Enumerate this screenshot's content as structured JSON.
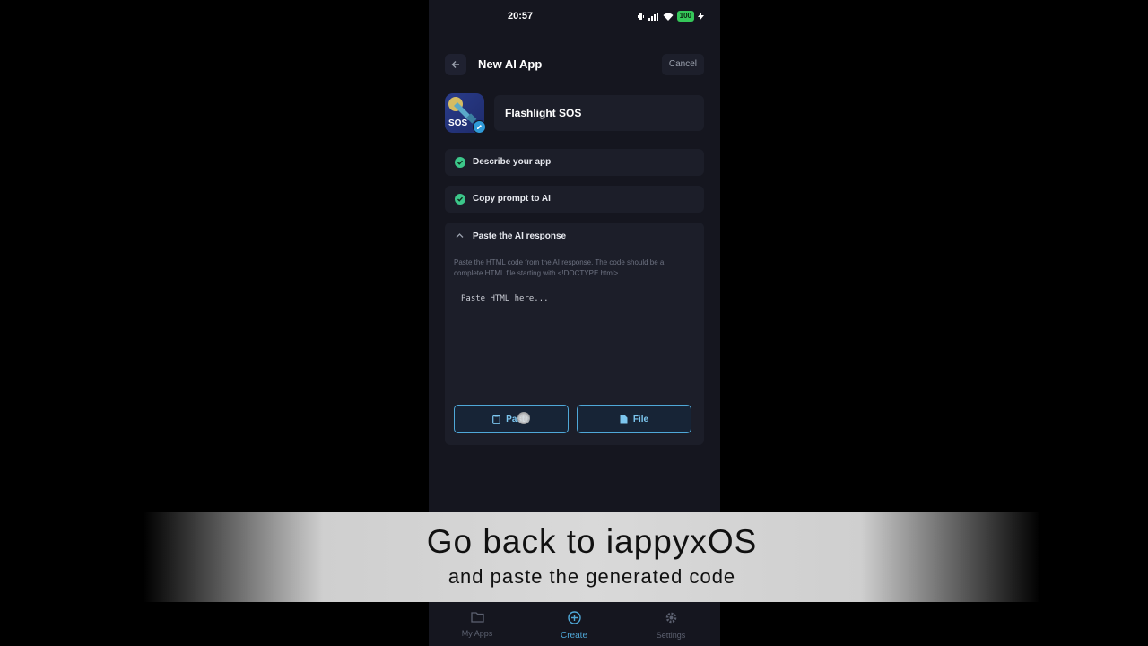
{
  "status_bar": {
    "time": "20:57",
    "battery": "100"
  },
  "header": {
    "title": "New AI App",
    "cancel_label": "Cancel"
  },
  "app": {
    "icon_text": "SOS",
    "name": "Flashlight SOS"
  },
  "steps": [
    {
      "label": "Describe your app",
      "done": true
    },
    {
      "label": "Copy prompt to AI",
      "done": true
    }
  ],
  "paste_section": {
    "title": "Paste the AI response",
    "description": "Paste the HTML code from the AI response. The code should be a complete HTML file starting with <!DOCTYPE html>.",
    "placeholder": "Paste HTML here...",
    "paste_label": "Paste",
    "file_label": "File"
  },
  "caption": {
    "line1": "Go back to iappyxOS",
    "line2": "and paste the generated code"
  },
  "bottom_nav": {
    "items": [
      {
        "label": "My Apps",
        "icon": "folder-icon",
        "active": false
      },
      {
        "label": "Create",
        "icon": "plus-circle-icon",
        "active": true
      },
      {
        "label": "Settings",
        "icon": "gear-icon",
        "active": false
      }
    ]
  },
  "colors": {
    "accent": "#4fa8d8",
    "success": "#3cc78a",
    "background": "#15161f",
    "card": "#1c1e29"
  }
}
